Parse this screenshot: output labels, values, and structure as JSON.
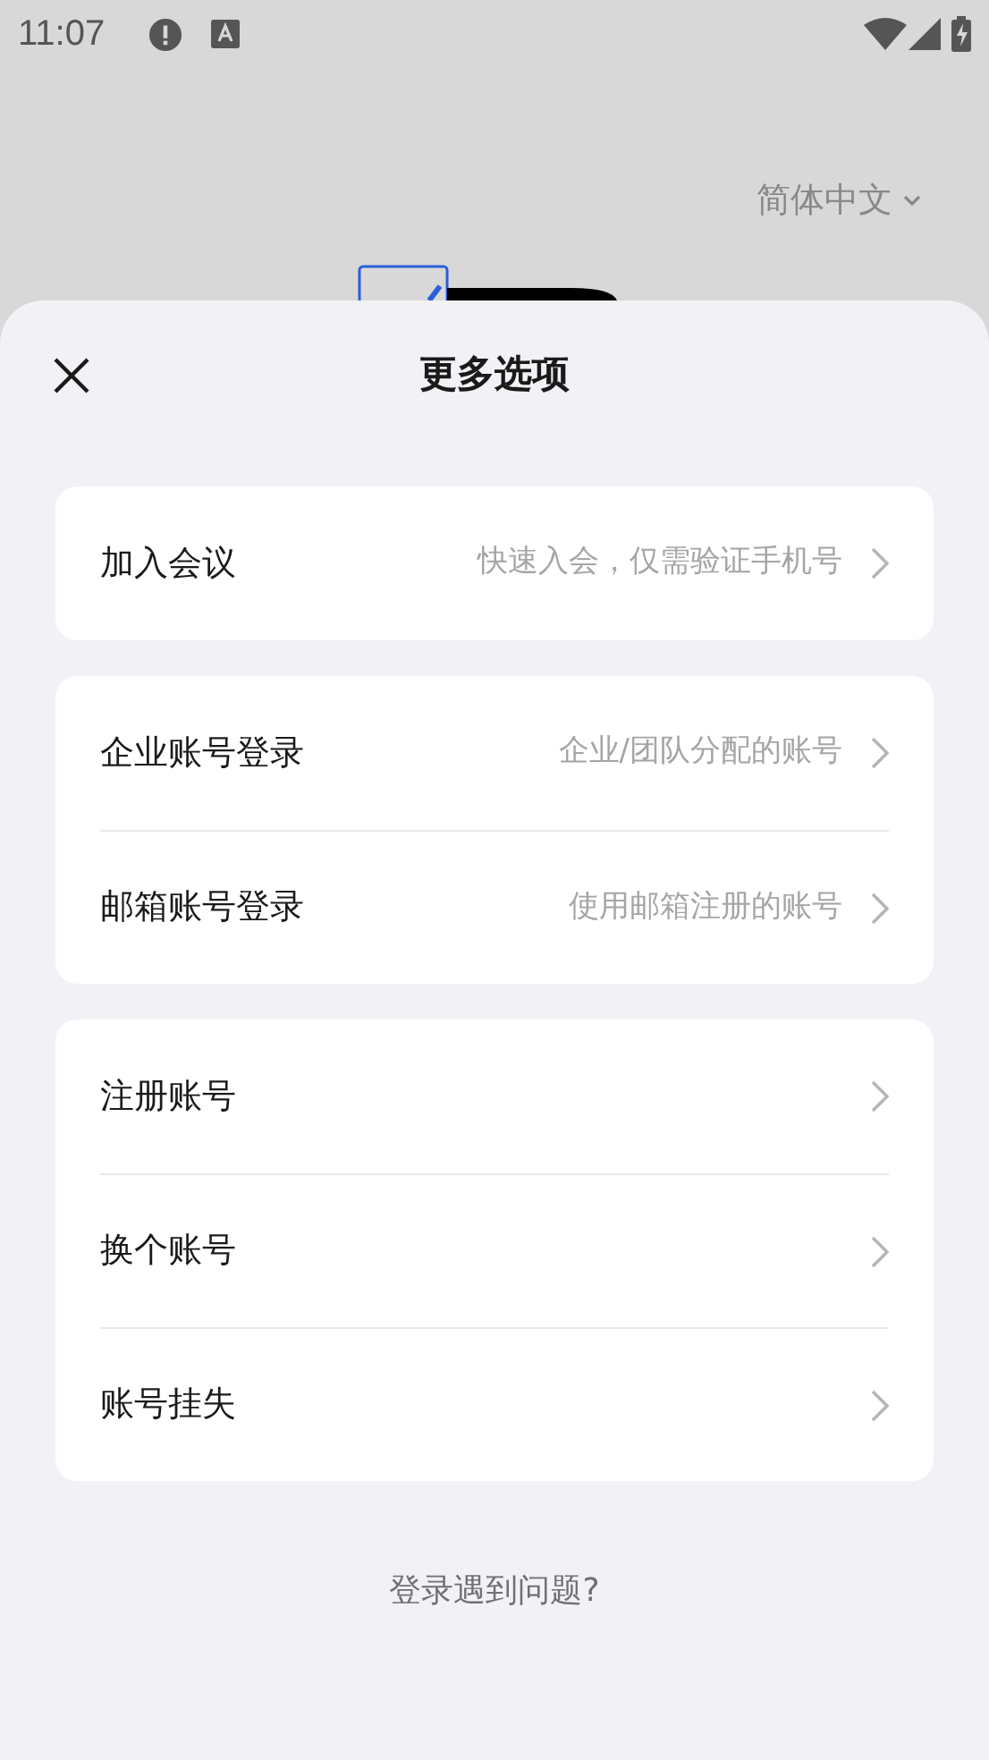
{
  "status_bar": {
    "time": "11:07"
  },
  "background": {
    "language": "简体中文"
  },
  "sheet": {
    "title": "更多选项",
    "groups": [
      {
        "rows": [
          {
            "label": "加入会议",
            "hint": "快速入会，仅需验证手机号"
          }
        ]
      },
      {
        "rows": [
          {
            "label": "企业账号登录",
            "hint": "企业/团队分配的账号"
          },
          {
            "label": "邮箱账号登录",
            "hint": "使用邮箱注册的账号"
          }
        ]
      },
      {
        "rows": [
          {
            "label": "注册账号"
          },
          {
            "label": "换个账号"
          },
          {
            "label": "账号挂失"
          }
        ]
      }
    ],
    "help_link": "登录遇到问题?"
  }
}
